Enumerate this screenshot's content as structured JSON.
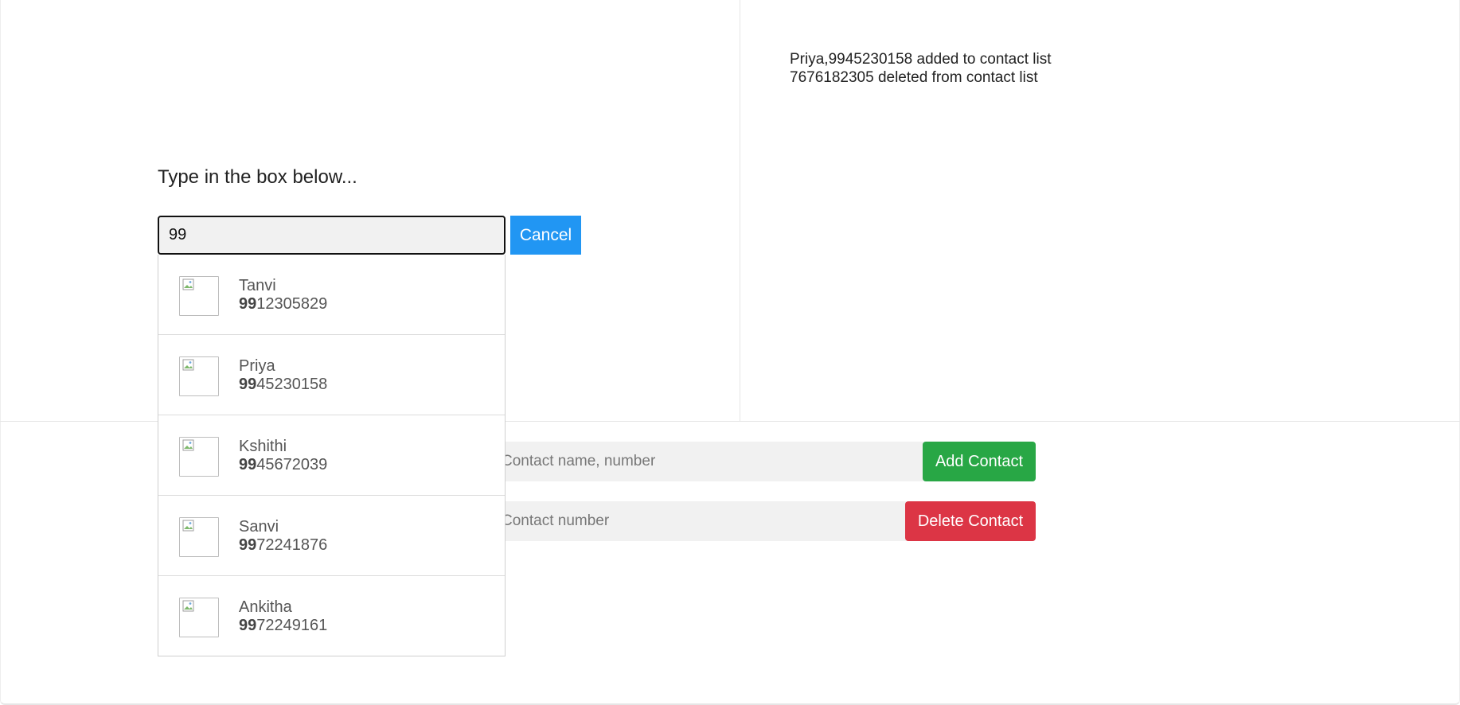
{
  "log": {
    "lines": [
      "Priya,9945230158 added to contact list",
      "7676182305 deleted from contact list"
    ]
  },
  "search": {
    "prompt": "Type in the box below...",
    "value": "99",
    "cancel_label": "Cancel"
  },
  "results": [
    {
      "name": "Tanvi",
      "match": "99",
      "rest": "12305829",
      "icon": "broken-image-icon"
    },
    {
      "name": "Priya",
      "match": "99",
      "rest": "45230158",
      "icon": "broken-image-icon"
    },
    {
      "name": "Kshithi",
      "match": "99",
      "rest": "45672039",
      "icon": "broken-image-icon"
    },
    {
      "name": "Sanvi",
      "match": "99",
      "rest": "72241876",
      "icon": "broken-image-icon"
    },
    {
      "name": "Ankitha",
      "match": "99",
      "rest": "72249161",
      "icon": "broken-image-icon"
    }
  ],
  "add_form": {
    "placeholder": "Contact name, number",
    "button_label": "Add Contact"
  },
  "delete_form": {
    "placeholder": "Contact number",
    "button_label": "Delete Contact"
  },
  "colors": {
    "cancel": "#2196f3",
    "add": "#28a745",
    "delete": "#dc3545"
  }
}
